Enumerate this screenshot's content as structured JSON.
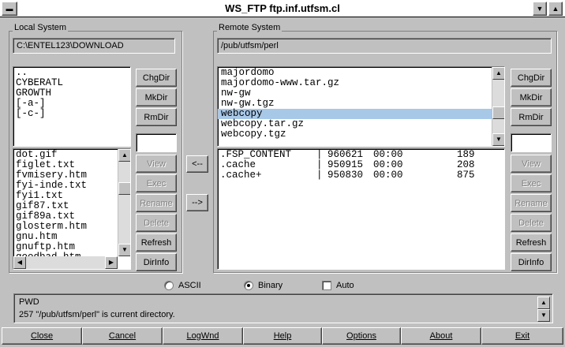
{
  "window": {
    "title": "WS_FTP ftp.inf.utfsm.cl"
  },
  "local": {
    "group_label": "Local System",
    "path": "C:\\ENTEL123\\DOWNLOAD",
    "dirs": [
      "..",
      "CYBERATL",
      "GROWTH",
      "[-a-]",
      "[-c-]"
    ],
    "files": [
      "dot.gif",
      "figlet.txt",
      "fvmisery.htm",
      "fyi-inde.txt",
      "fyi1.txt",
      "gif87.txt",
      "gif89a.txt",
      "glosterm.htm",
      "gnu.htm",
      "gnuftp.htm",
      "goodbad.htm"
    ]
  },
  "remote": {
    "group_label": "Remote System",
    "path": "/pub/utfsm/perl",
    "dirs": [
      "majordomo",
      "majordomo-www.tar.gz",
      "nw-gw",
      "nw-gw.tgz",
      "webcopy",
      "webcopy.tar.gz",
      "webcopy.tgz"
    ],
    "selected_dir": "webcopy",
    "files": [
      {
        "name": ".FSP_CONTENT",
        "sep": "|",
        "date": "960621",
        "time": "00:00",
        "size": "189"
      },
      {
        "name": ".cache",
        "sep": "|",
        "date": "950915",
        "time": "00:00",
        "size": "208"
      },
      {
        "name": ".cache+",
        "sep": "|",
        "date": "950830",
        "time": "00:00",
        "size": "875"
      }
    ]
  },
  "buttons": {
    "chgdir": "ChgDir",
    "mkdir": "MkDir",
    "rmdir": "RmDir",
    "view": "View",
    "exec": "Exec",
    "rename": "Rename",
    "delete": "Delete",
    "refresh": "Refresh",
    "dirinfo": "DirInfo",
    "to_local": "<--",
    "to_remote": "-->"
  },
  "mode": {
    "ascii": "ASCII",
    "binary": "Binary",
    "auto": "Auto",
    "selected": "Binary"
  },
  "status": {
    "line1": "PWD",
    "line2": "257 \"/pub/utfsm/perl\" is current directory."
  },
  "bottom": [
    "Close",
    "Cancel",
    "LogWnd",
    "Help",
    "Options",
    "About",
    "Exit"
  ]
}
